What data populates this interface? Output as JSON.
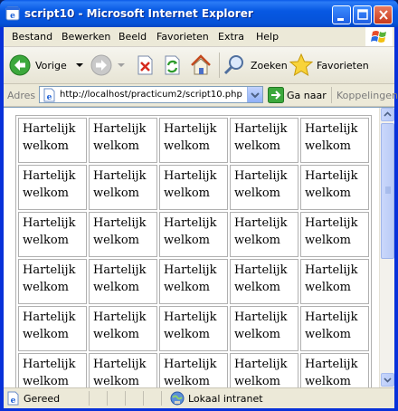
{
  "window": {
    "title": "script10 - Microsoft Internet Explorer"
  },
  "menu": {
    "items": [
      "Bestand",
      "Bewerken",
      "Beeld",
      "Favorieten",
      "Extra",
      "Help"
    ]
  },
  "toolbar": {
    "back_label": "Vorige",
    "search_label": "Zoeken",
    "favorites_label": "Favorieten"
  },
  "address": {
    "label": "Adres",
    "url": "http://localhost/practicum2/script10.php",
    "go_label": "Ga naar",
    "links_label": "Koppelingen"
  },
  "page": {
    "cell_text": "Hartelijk welkom",
    "rows": 6,
    "columns": 5
  },
  "status": {
    "text": "Gereed",
    "zone": "Lokaal intranet"
  }
}
